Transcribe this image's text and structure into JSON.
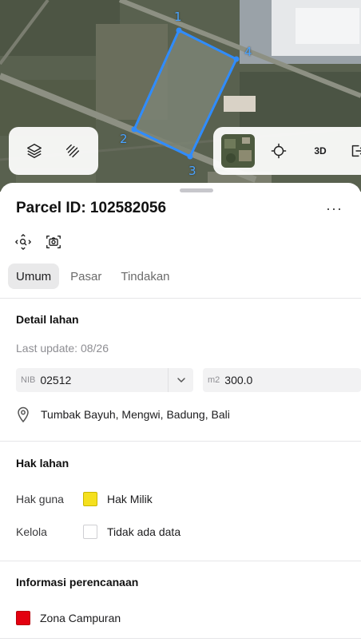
{
  "map": {
    "corner_labels": [
      "1",
      "4",
      "2",
      "3"
    ],
    "left_controls": [
      {
        "icon": "layers-icon"
      },
      {
        "icon": "draw-icon"
      }
    ],
    "right_controls": [
      {
        "icon": "satellite-thumbnail"
      },
      {
        "icon": "locate-icon"
      },
      {
        "label": "3D"
      },
      {
        "icon": "export-icon"
      }
    ]
  },
  "parcel": {
    "title": "Parcel ID: 102582056",
    "more_label": "···"
  },
  "tabs": [
    "Umum",
    "Pasar",
    "Tindakan"
  ],
  "detail": {
    "section_title": "Detail lahan",
    "last_update": "Last update: 08/26",
    "nib_label": "NIB",
    "nib_value": "02512",
    "area_label": "m2",
    "area_value": "300.0",
    "location": "Tumbak Bayuh, Mengwi, Badung, Bali"
  },
  "rights": {
    "section_title": "Hak lahan",
    "rows": [
      {
        "label": "Hak guna",
        "value": "Hak Milik",
        "color": "#f5e01e"
      },
      {
        "label": "Kelola",
        "value": "Tidak ada data",
        "color": "#ffffff"
      }
    ]
  },
  "planning": {
    "section_title": "Informasi perencanaan",
    "zone": "Zona Campuran",
    "zone_color": "#e3000f"
  },
  "colors": {
    "accent": "#2f8cff",
    "tab_active_bg": "#e9e9ea"
  }
}
